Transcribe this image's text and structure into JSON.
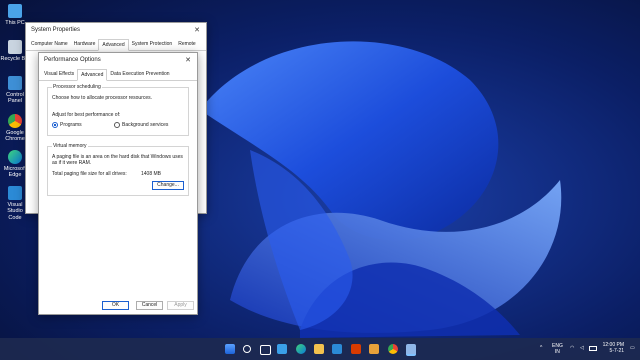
{
  "desktop": {
    "icons": [
      {
        "label": "This PC"
      },
      {
        "label": "Recycle Bin"
      },
      {
        "label": "Control Panel"
      },
      {
        "label": "Google Chrome"
      },
      {
        "label": "Microsoft Edge"
      },
      {
        "label": "Visual Studio Code"
      }
    ]
  },
  "system_properties": {
    "title": "System Properties",
    "tabs": [
      "Computer Name",
      "Hardware",
      "Advanced",
      "System Protection",
      "Remote"
    ],
    "active_tab": "Advanced"
  },
  "performance_options": {
    "title": "Performance Options",
    "tabs": [
      "Visual Effects",
      "Advanced",
      "Data Execution Prevention"
    ],
    "processor_scheduling": {
      "title": "Processor scheduling",
      "description": "Choose how to allocate processor resources.",
      "adjust_label": "Adjust for best performance of:",
      "option_programs": "Programs",
      "option_background": "Background services",
      "selected": "Programs"
    },
    "virtual_memory": {
      "title": "Virtual memory",
      "description": "A paging file is an area on the hard disk that Windows uses as if it were RAM.",
      "total_label": "Total paging file size for all drives:",
      "total_value": "1408 MB",
      "change_button": "Change..."
    },
    "buttons": {
      "ok": "OK",
      "cancel": "Cancel",
      "apply": "Apply"
    }
  },
  "taskbar": {
    "language": "ENG",
    "region": "IN",
    "time": "12:00 PM",
    "date": "5-7-21"
  }
}
